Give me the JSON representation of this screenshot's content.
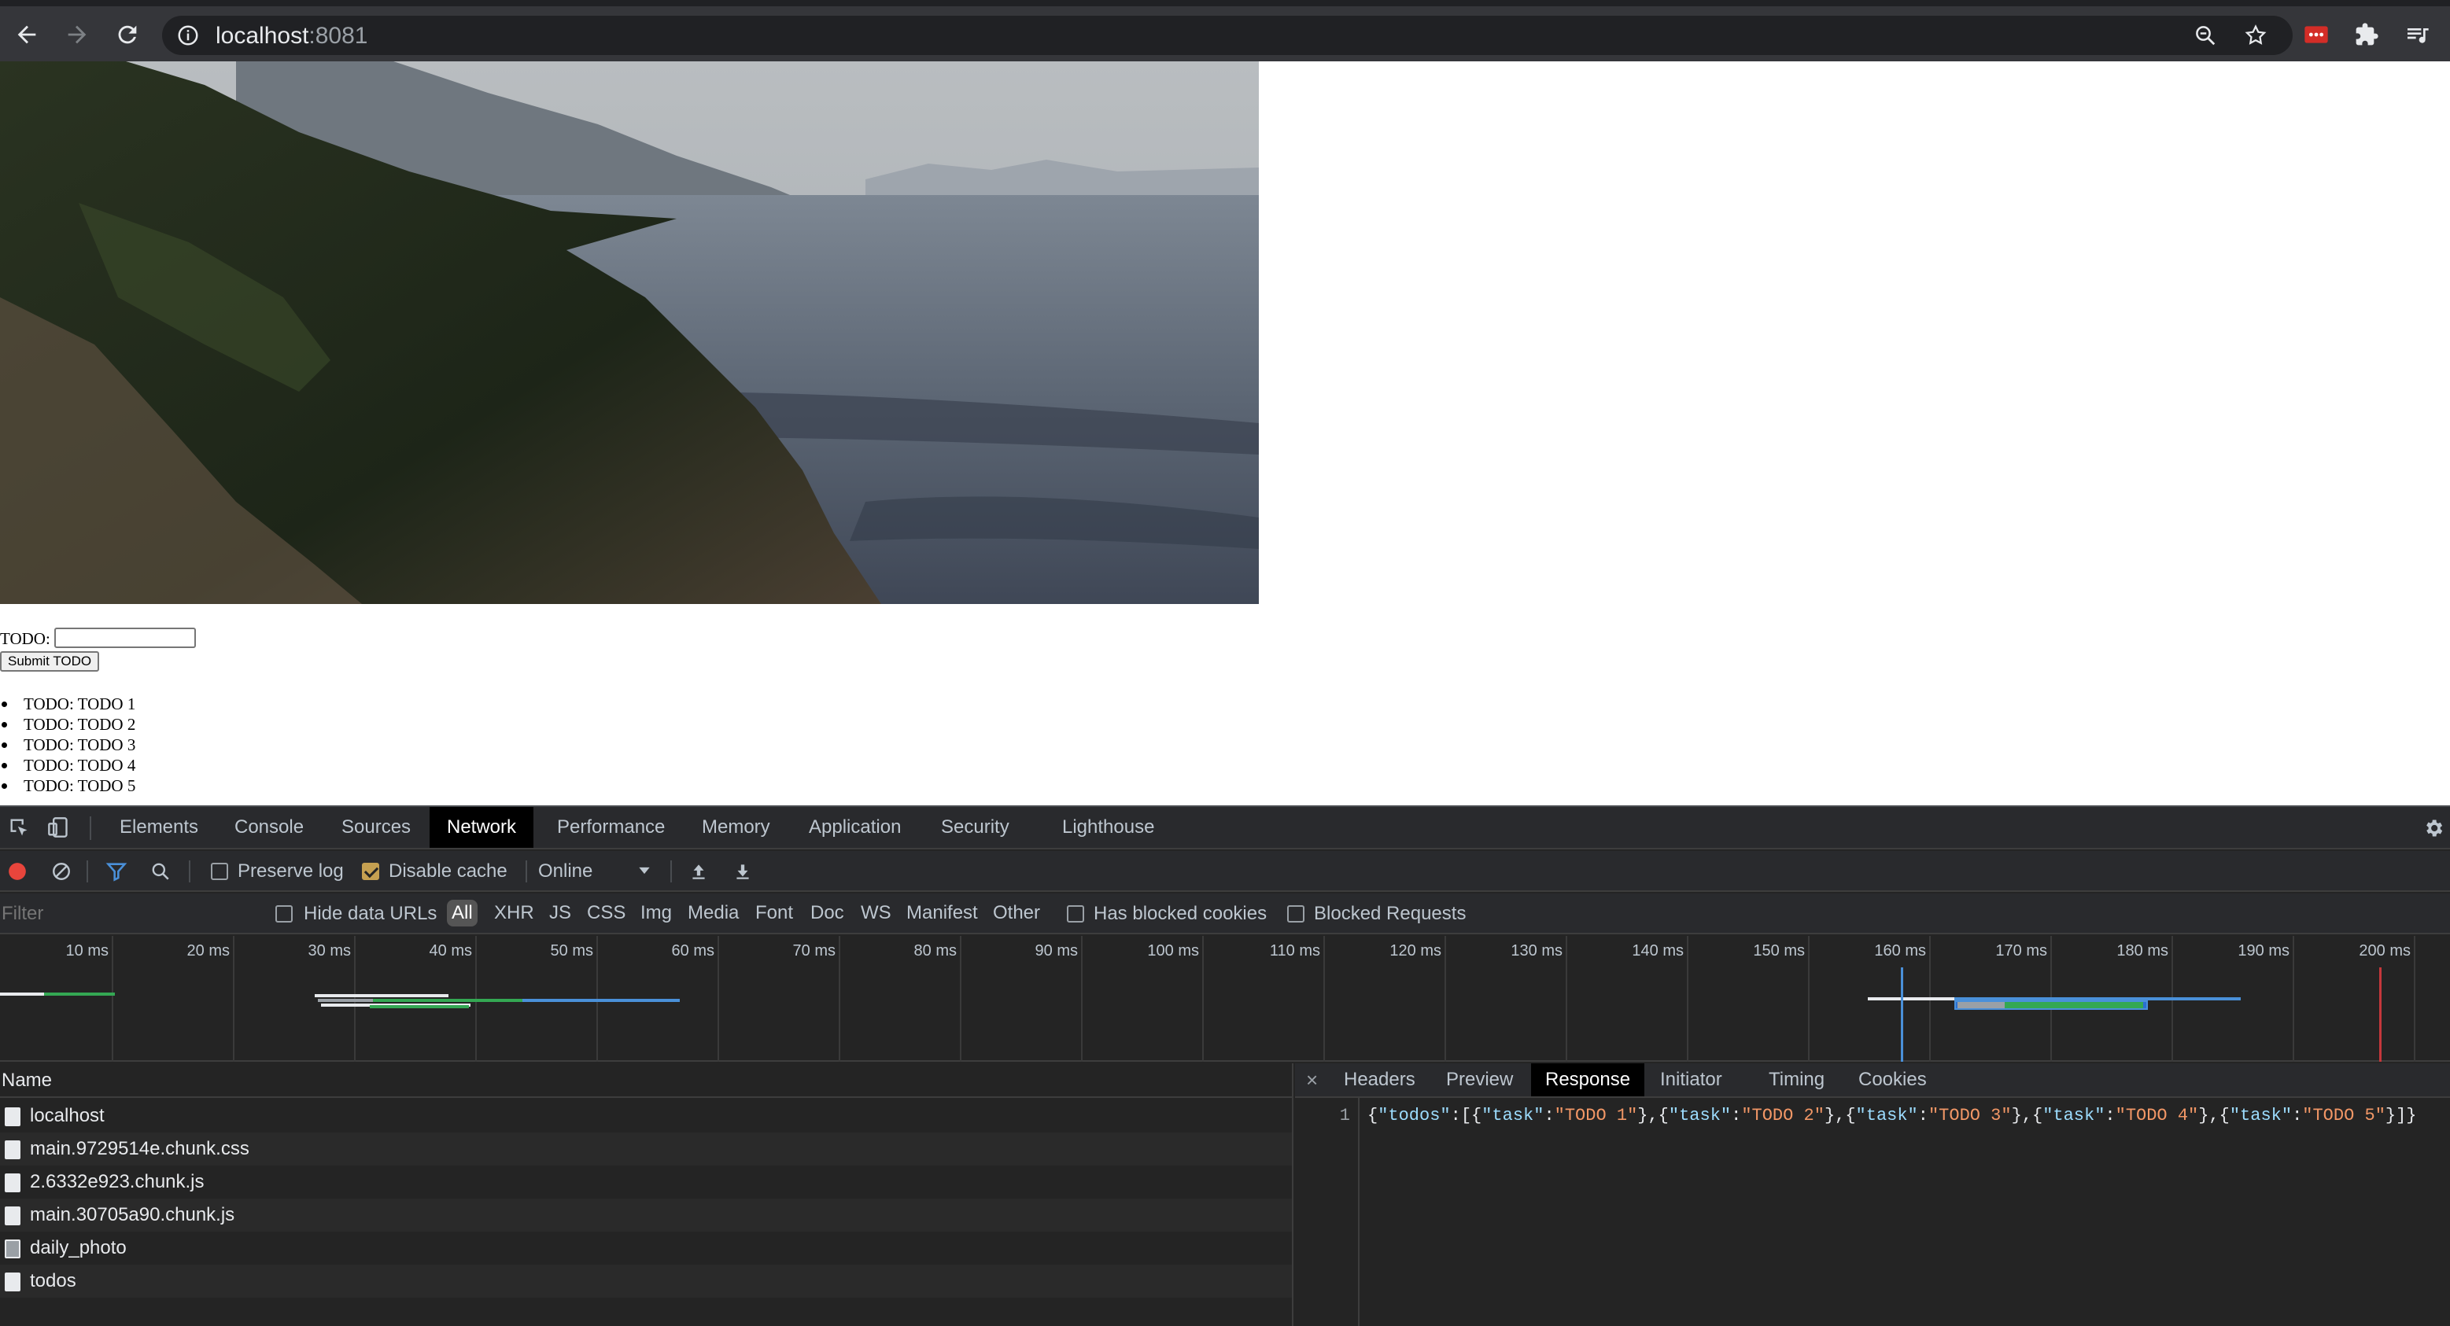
{
  "browser": {
    "url_host": "localhost",
    "url_port": ":8081"
  },
  "page": {
    "todo_label": "TODO:",
    "todo_input_value": "",
    "submit_label": "Submit TODO",
    "todos": [
      "TODO: TODO 1",
      "TODO: TODO 2",
      "TODO: TODO 3",
      "TODO: TODO 4",
      "TODO: TODO 5"
    ]
  },
  "devtools": {
    "tabs": [
      "Elements",
      "Console",
      "Sources",
      "Network",
      "Performance",
      "Memory",
      "Application",
      "Security",
      "Lighthouse"
    ],
    "active_tab": "Network",
    "toolbar": {
      "preserve_log": "Preserve log",
      "preserve_log_checked": false,
      "disable_cache": "Disable cache",
      "disable_cache_checked": true,
      "throttle": "Online"
    },
    "filter": {
      "placeholder": "Filter",
      "hide_data_urls": "Hide data URLs",
      "types": [
        "All",
        "XHR",
        "JS",
        "CSS",
        "Img",
        "Media",
        "Font",
        "Doc",
        "WS",
        "Manifest",
        "Other"
      ],
      "active_type": "All",
      "has_blocked_cookies": "Has blocked cookies",
      "blocked_requests": "Blocked Requests"
    },
    "timeline_ticks": [
      "10 ms",
      "20 ms",
      "30 ms",
      "40 ms",
      "50 ms",
      "60 ms",
      "70 ms",
      "80 ms",
      "90 ms",
      "100 ms",
      "110 ms",
      "120 ms",
      "130 ms",
      "140 ms",
      "150 ms",
      "160 ms",
      "170 ms",
      "180 ms",
      "190 ms",
      "200 ms"
    ],
    "name_header": "Name",
    "requests": [
      {
        "name": "localhost",
        "icon": "document-icon"
      },
      {
        "name": "main.9729514e.chunk.css",
        "icon": "document-icon"
      },
      {
        "name": "2.6332e923.chunk.js",
        "icon": "document-icon"
      },
      {
        "name": "main.30705a90.chunk.js",
        "icon": "document-icon"
      },
      {
        "name": "daily_photo",
        "icon": "image-icon"
      },
      {
        "name": "todos",
        "icon": "document-icon"
      }
    ],
    "detail_tabs": [
      "Headers",
      "Preview",
      "Response",
      "Initiator",
      "Timing",
      "Cookies"
    ],
    "active_detail_tab": "Response",
    "response_line_number": "1",
    "response_text": "{\"todos\":[{\"task\":\"TODO 1\"},{\"task\":\"TODO 2\"},{\"task\":\"TODO 3\"},{\"task\":\"TODO 4\"},{\"task\":\"TODO 5\"}]}"
  },
  "colors": {
    "record_red": "#e8453c",
    "accent_blue": "#1a73e8",
    "json_key": "#9cdcfe",
    "json_string": "#f29766",
    "timeline_green": "#34a853",
    "timeline_blue": "#4a90d9",
    "timeline_red": "#c5373b"
  }
}
